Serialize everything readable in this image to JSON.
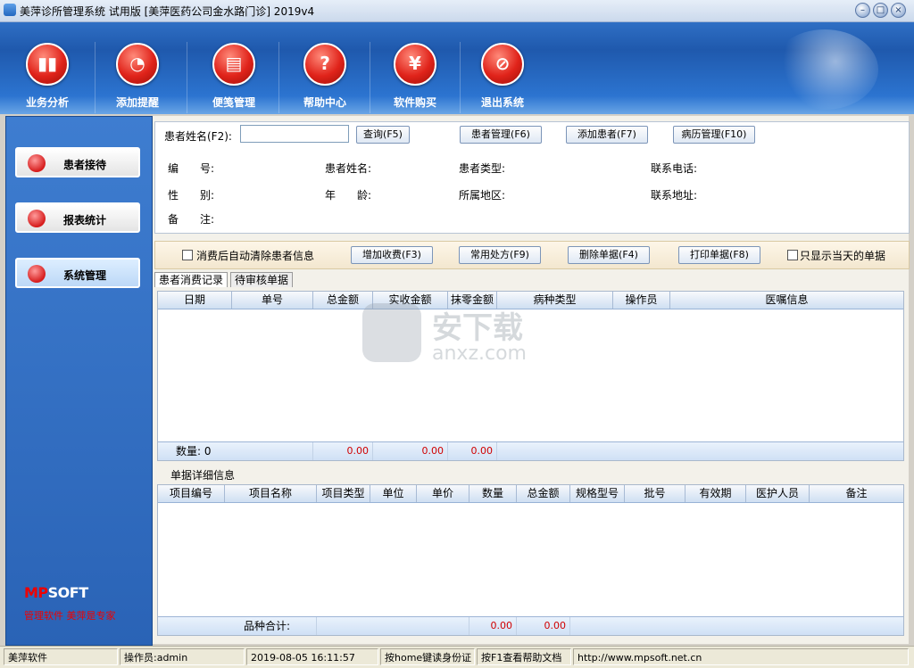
{
  "window": {
    "title": "美萍诊所管理系统 试用版 [美萍医药公司金水路门诊] 2019v4"
  },
  "toolbar": [
    {
      "label": "业务分析",
      "icon": "bar-chart-icon"
    },
    {
      "label": "添加提醒",
      "icon": "clock-icon"
    },
    {
      "label": "便笺管理",
      "icon": "notepad-icon"
    },
    {
      "label": "帮助中心",
      "icon": "help-icon"
    },
    {
      "label": "软件购买",
      "icon": "yen-icon"
    },
    {
      "label": "退出系统",
      "icon": "exit-icon"
    }
  ],
  "sidebar": {
    "items": [
      {
        "label": "患者接待",
        "active": false
      },
      {
        "label": "报表统计",
        "active": false
      },
      {
        "label": "系统管理",
        "active": true
      }
    ],
    "logo": {
      "brand_a": "MP",
      "brand_b": "SOFT",
      "tagline": "管理软件 美萍是专家"
    }
  },
  "patient": {
    "name_label": "患者姓名(F2):",
    "name_value": "",
    "query_btn": "查询(F5)",
    "manage_btn": "患者管理(F6)",
    "add_btn": "添加患者(F7)",
    "history_btn": "病历管理(F10)",
    "fields": {
      "id": "编　　号:",
      "name": "患者姓名:",
      "type": "患者类型:",
      "phone": "联系电话:",
      "sex": "性　　别:",
      "age": "年　　龄:",
      "region": "所属地区:",
      "address": "联系地址:",
      "note": "备　　注:"
    }
  },
  "actions": {
    "auto_clear": "消费后自动清除患者信息",
    "add_charge": "增加收费(F3)",
    "common_rx": "常用处方(F9)",
    "delete_bill": "删除单据(F4)",
    "print_bill": "打印单据(F8)",
    "today_only": "只显示当天的单据"
  },
  "tabs": [
    {
      "label": "患者消费记录",
      "active": true
    },
    {
      "label": "待审核单据",
      "active": false
    }
  ],
  "records_grid": {
    "columns": [
      "日期",
      "单号",
      "总金额",
      "实收金额",
      "抹零金额",
      "病种类型",
      "操作员",
      "医嘱信息"
    ],
    "footer": {
      "count": "数量: 0",
      "total": "0.00",
      "received": "0.00",
      "rounding": "0.00"
    }
  },
  "detail": {
    "title": "单据详细信息",
    "columns": [
      "项目编号",
      "项目名称",
      "项目类型",
      "单位",
      "单价",
      "数量",
      "总金额",
      "规格型号",
      "批号",
      "有效期",
      "医护人员",
      "备注"
    ],
    "footer": {
      "label": "品种合计:",
      "qty": "0.00",
      "total": "0.00"
    }
  },
  "watermark": {
    "t1": "安下载",
    "t2": "anxz.com"
  },
  "statusbar": {
    "company": "美萍软件",
    "operator": "操作员:admin",
    "datetime": "2019-08-05 16:11:57",
    "hint1": "按home键读身份证",
    "hint2": "按F1查看帮助文档",
    "url": "http://www.mpsoft.net.cn"
  },
  "colors": {
    "accent": "#2a63b6",
    "alert": "#d00000"
  }
}
